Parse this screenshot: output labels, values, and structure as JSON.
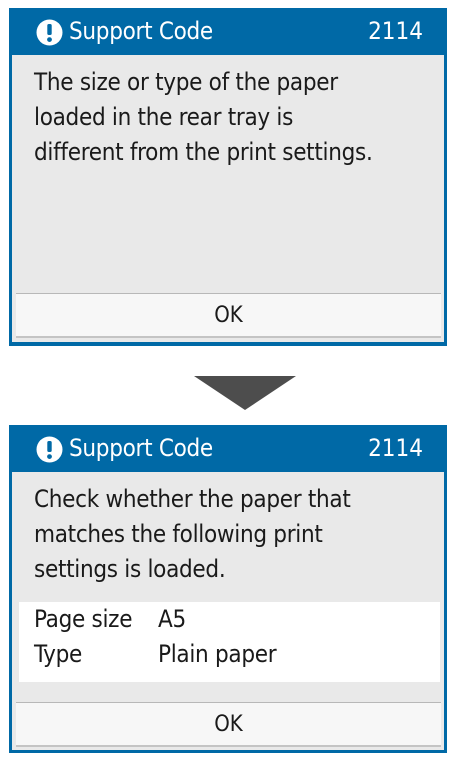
{
  "screen1": {
    "header": {
      "title": "Support Code",
      "code": "2114",
      "icon": "exclamation-circle-icon"
    },
    "message": "The size or type of the paper\nloaded in the rear tray is\ndifferent from the print settings.",
    "ok_label": "OK"
  },
  "arrow": {
    "icon": "down-arrow-icon",
    "color": "#4d4d4d"
  },
  "screen2": {
    "header": {
      "title": "Support Code",
      "code": "2114",
      "icon": "exclamation-circle-icon"
    },
    "message": "Check whether the paper that\nmatches the following print\nsettings is loaded.",
    "settings": {
      "page_size": {
        "label": "Page size",
        "value": "A5"
      },
      "type": {
        "label": "Type",
        "value": "Plain paper"
      }
    },
    "ok_label": "OK"
  },
  "colors": {
    "header_blue": "#0069a6",
    "panel_gray": "#e9e9e9"
  }
}
